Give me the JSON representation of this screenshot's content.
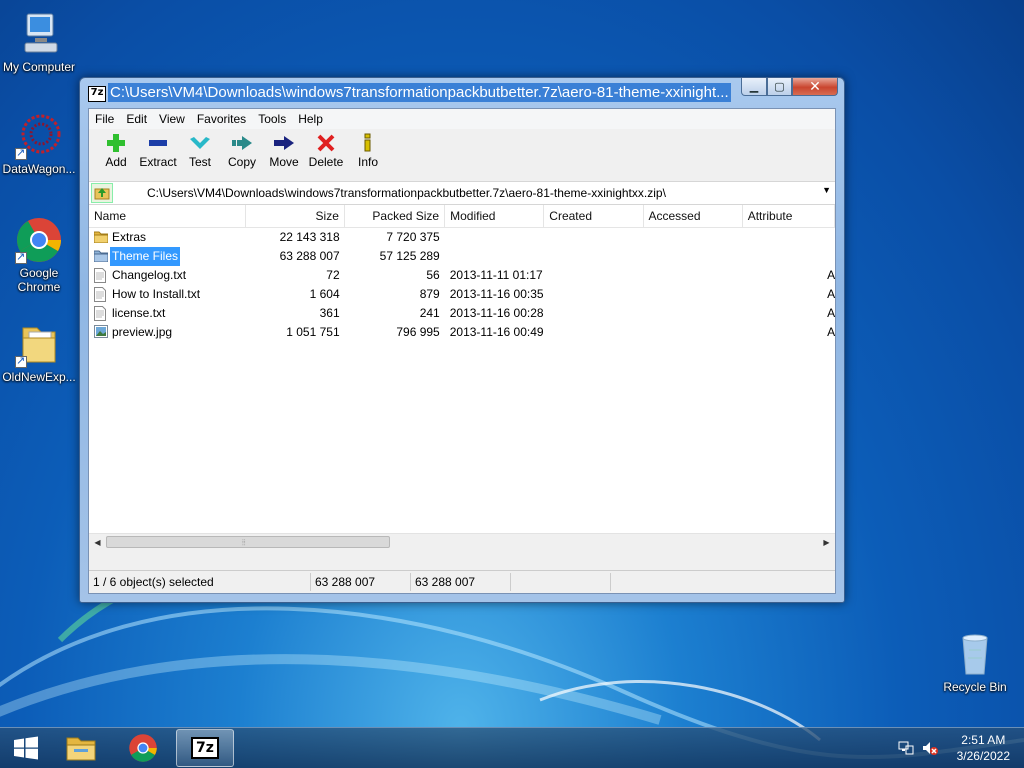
{
  "desktop": {
    "icons": [
      {
        "label": "My Computer"
      },
      {
        "label": "DataWagon..."
      },
      {
        "label": "Google Chrome"
      },
      {
        "label": "OldNewExp..."
      },
      {
        "label": "Recycle Bin"
      }
    ]
  },
  "window": {
    "title": "C:\\Users\\VM4\\Downloads\\windows7transformationpackbutbetter.7z\\aero-81-theme-xxinight...",
    "app_icon": "7z",
    "buttons": {
      "minimize": "minimize-icon",
      "maximize": "maximize-icon",
      "close": "close-icon"
    }
  },
  "menu": [
    "File",
    "Edit",
    "View",
    "Favorites",
    "Tools",
    "Help"
  ],
  "toolbar": [
    {
      "label": "Add",
      "icon": "plus-icon",
      "color": "#2fbf2f"
    },
    {
      "label": "Extract",
      "icon": "minus-icon",
      "color": "#1c3ea8"
    },
    {
      "label": "Test",
      "icon": "check-icon",
      "color": "#28b8c8"
    },
    {
      "label": "Copy",
      "icon": "copy-arrow-icon",
      "color": "#2a8a8a"
    },
    {
      "label": "Move",
      "icon": "move-arrow-icon",
      "color": "#1a237e"
    },
    {
      "label": "Delete",
      "icon": "delete-x-icon",
      "color": "#e02020"
    },
    {
      "label": "Info",
      "icon": "info-icon",
      "color": "#d8c000"
    }
  ],
  "address": {
    "path": "C:\\Users\\VM4\\Downloads\\windows7transformationpackbutbetter.7z\\aero-81-theme-xxinightxx.zip\\"
  },
  "columns": [
    "Name",
    "Size",
    "Packed Size",
    "Modified",
    "Created",
    "Accessed",
    "Attribute"
  ],
  "files": [
    {
      "name": "Extras",
      "type": "folder",
      "size": "22 143 318",
      "packed": "7 720 375",
      "modified": "",
      "created": "",
      "accessed": "",
      "attr": "",
      "selected": false
    },
    {
      "name": "Theme Files",
      "type": "folder",
      "size": "63 288 007",
      "packed": "57 125 289",
      "modified": "",
      "created": "",
      "accessed": "",
      "attr": "",
      "selected": true
    },
    {
      "name": "Changelog.txt",
      "type": "text",
      "size": "72",
      "packed": "56",
      "modified": "2013-11-11 01:17",
      "created": "",
      "accessed": "",
      "attr": "A",
      "selected": false
    },
    {
      "name": "How to Install.txt",
      "type": "text",
      "size": "1 604",
      "packed": "879",
      "modified": "2013-11-16 00:35",
      "created": "",
      "accessed": "",
      "attr": "A",
      "selected": false
    },
    {
      "name": "license.txt",
      "type": "text",
      "size": "361",
      "packed": "241",
      "modified": "2013-11-16 00:28",
      "created": "",
      "accessed": "",
      "attr": "A",
      "selected": false
    },
    {
      "name": "preview.jpg",
      "type": "image",
      "size": "1 051 751",
      "packed": "796 995",
      "modified": "2013-11-16 00:49",
      "created": "",
      "accessed": "",
      "attr": "A",
      "selected": false
    }
  ],
  "status": {
    "selection": "1 / 6 object(s) selected",
    "size": "63 288 007",
    "packed": "63 288 007"
  },
  "taskbar": {
    "start_icon": "windows-logo-icon",
    "pinned": [
      "file-explorer-icon",
      "chrome-icon",
      "7zip-icon"
    ],
    "active_label": "7z",
    "clock_time": "2:51 AM",
    "clock_date": "3/26/2022"
  }
}
